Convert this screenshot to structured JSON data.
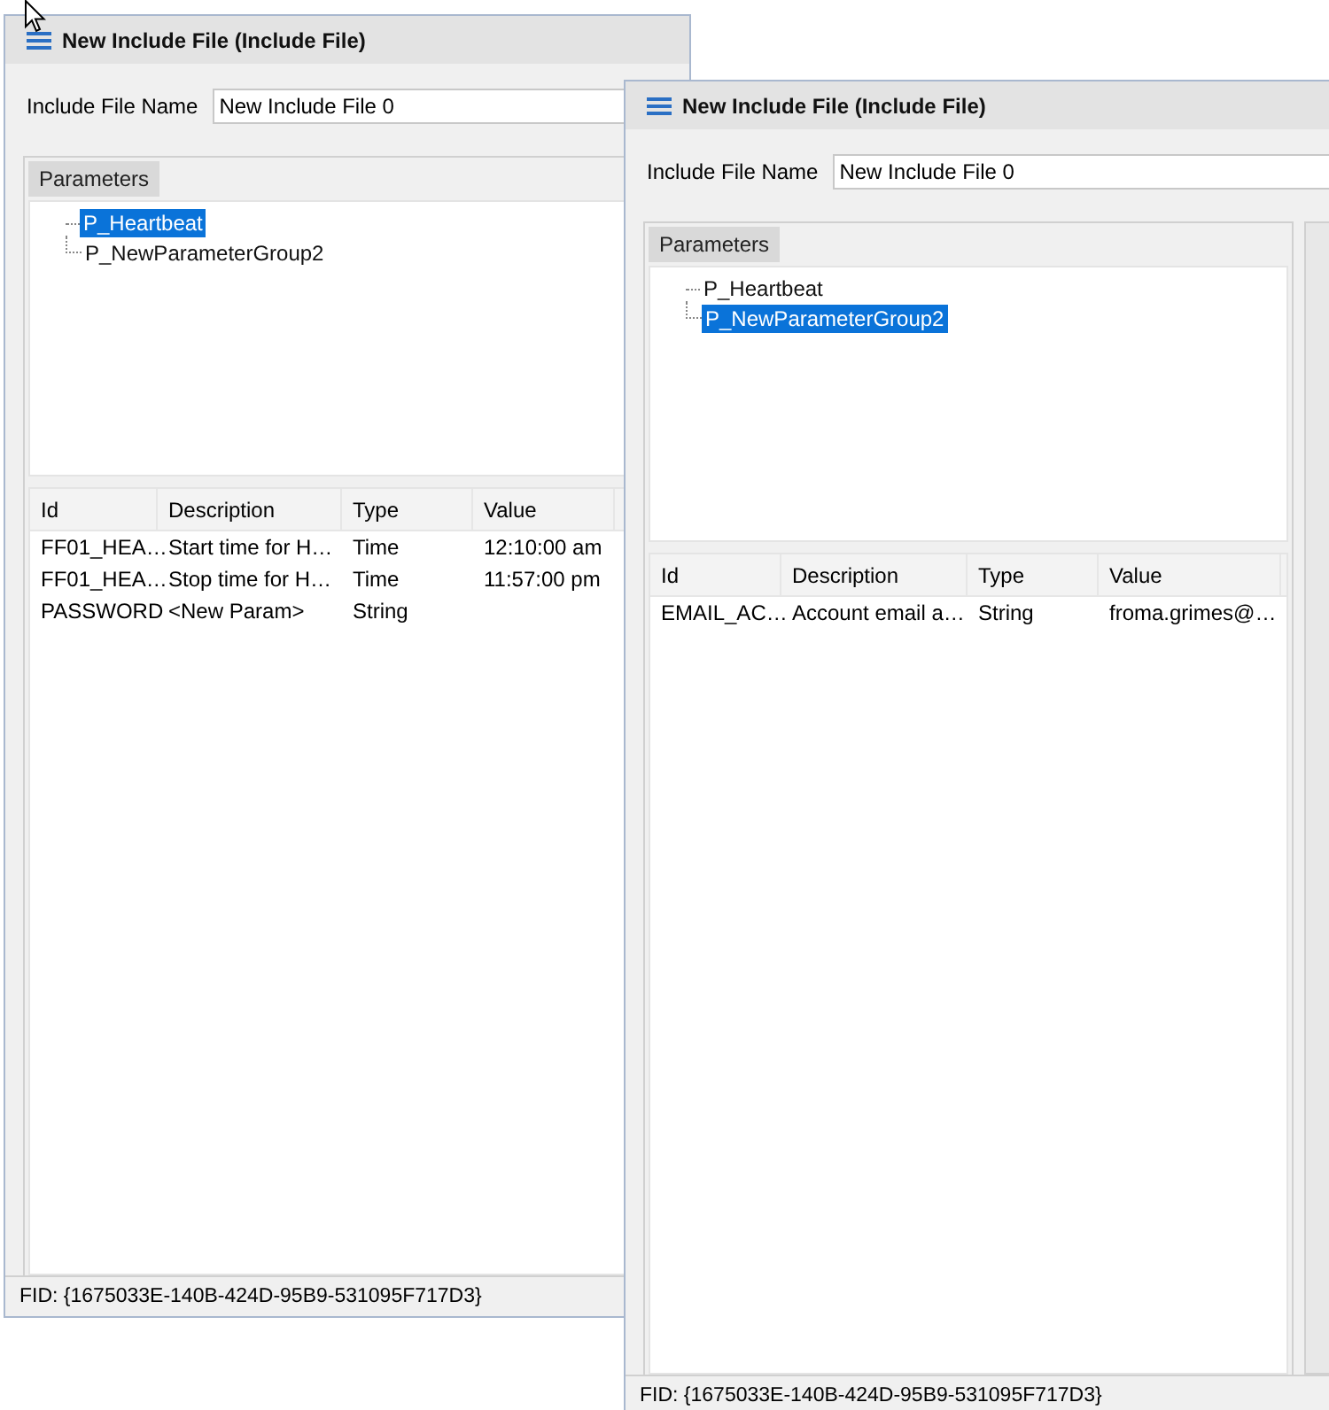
{
  "windows": [
    {
      "title": "New Include File (Include File)",
      "name_label": "Include File Name",
      "name_value": "New Include File 0",
      "tab": {
        "label": "Parameters",
        "selected": true
      },
      "tree": [
        {
          "label": "P_Heartbeat",
          "selected": true
        },
        {
          "label": "P_NewParameterGroup2",
          "selected": false
        }
      ],
      "table": {
        "columns": [
          "Id",
          "Description",
          "Type",
          "Value"
        ],
        "rows": [
          [
            "FF01_HEA…",
            "Start time for H…",
            "Time",
            "12:10:00 am"
          ],
          [
            "FF01_HEA…",
            "Stop time for H…",
            "Time",
            "11:57:00 pm"
          ],
          [
            "PASSWORD",
            "<New Param>",
            "String",
            ""
          ]
        ]
      },
      "status": "FID: {1675033E-140B-424D-95B9-531095F717D3}"
    },
    {
      "title": "New Include File (Include File)",
      "name_label": "Include File Name",
      "name_value": "New Include File 0",
      "tab": {
        "label": "Parameters",
        "selected": true
      },
      "tree": [
        {
          "label": "P_Heartbeat",
          "selected": false
        },
        {
          "label": "P_NewParameterGroup2",
          "selected": true
        }
      ],
      "table": {
        "columns": [
          "Id",
          "Description",
          "Type",
          "Value"
        ],
        "rows": [
          [
            "EMAIL_AC…",
            "Account email a…",
            "String",
            "froma.grimes@…"
          ]
        ]
      },
      "status": "FID: {1675033E-140B-424D-95B9-531095F717D3}"
    }
  ]
}
